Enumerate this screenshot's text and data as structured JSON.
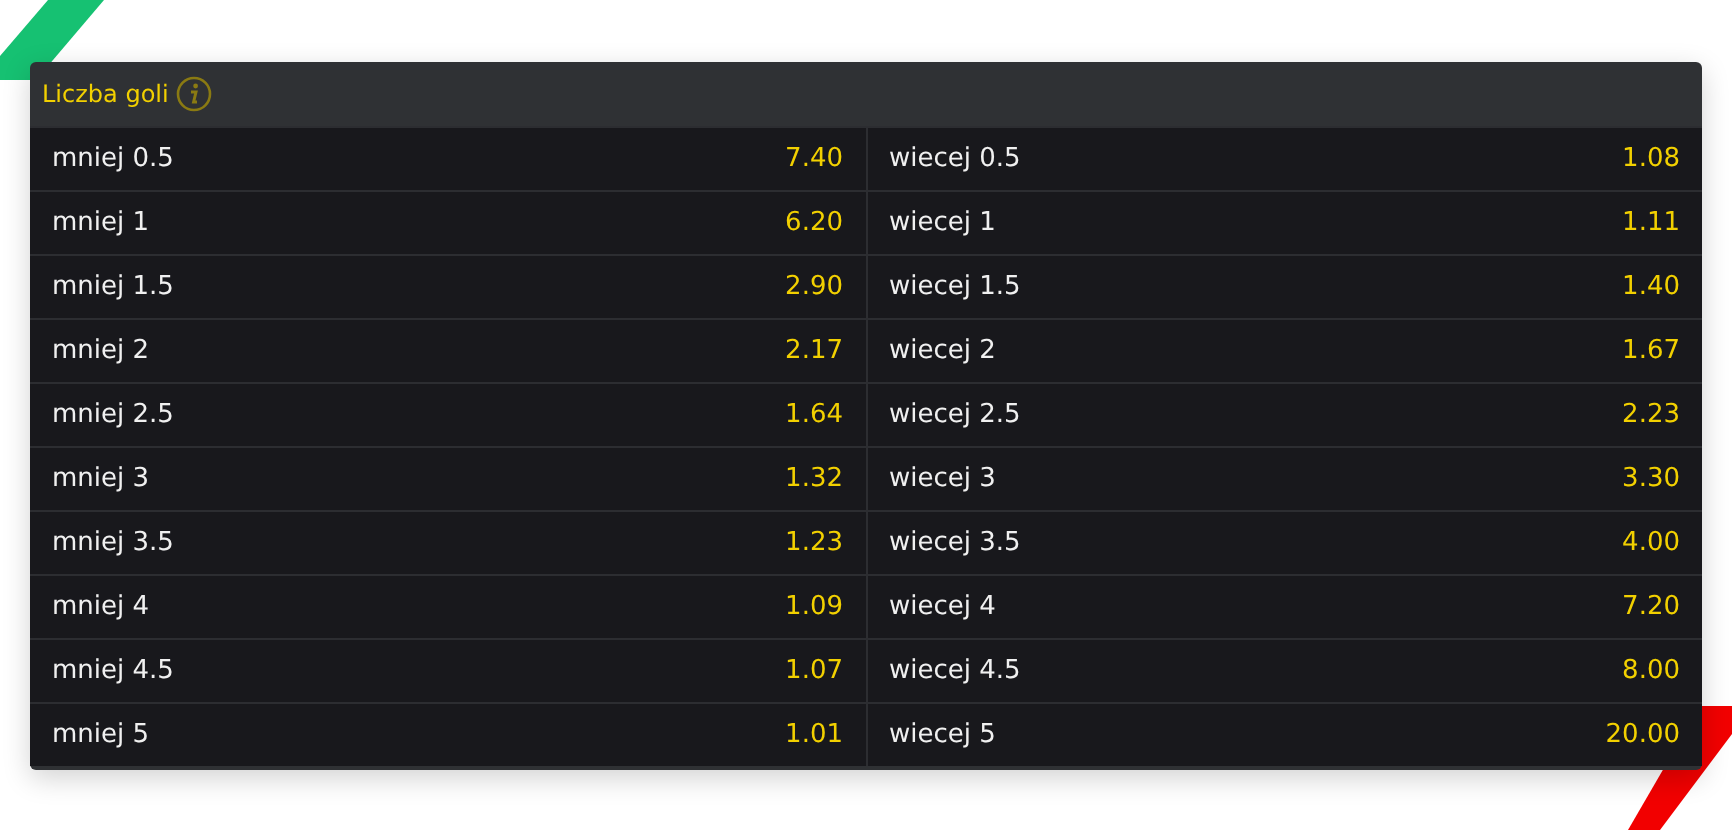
{
  "market": {
    "title": "Liczba goli",
    "rows": [
      [
        {
          "label": "mniej 0.5",
          "odds": "7.40"
        },
        {
          "label": "wiecej 0.5",
          "odds": "1.08"
        }
      ],
      [
        {
          "label": "mniej 1",
          "odds": "6.20"
        },
        {
          "label": "wiecej 1",
          "odds": "1.11"
        }
      ],
      [
        {
          "label": "mniej 1.5",
          "odds": "2.90"
        },
        {
          "label": "wiecej 1.5",
          "odds": "1.40"
        }
      ],
      [
        {
          "label": "mniej 2",
          "odds": "2.17"
        },
        {
          "label": "wiecej 2",
          "odds": "1.67"
        }
      ],
      [
        {
          "label": "mniej 2.5",
          "odds": "1.64"
        },
        {
          "label": "wiecej 2.5",
          "odds": "2.23"
        }
      ],
      [
        {
          "label": "mniej 3",
          "odds": "1.32"
        },
        {
          "label": "wiecej 3",
          "odds": "3.30"
        }
      ],
      [
        {
          "label": "mniej 3.5",
          "odds": "1.23"
        },
        {
          "label": "wiecej 3.5",
          "odds": "4.00"
        }
      ],
      [
        {
          "label": "mniej 4",
          "odds": "1.09"
        },
        {
          "label": "wiecej 4",
          "odds": "7.20"
        }
      ],
      [
        {
          "label": "mniej 4.5",
          "odds": "1.07"
        },
        {
          "label": "wiecej 4.5",
          "odds": "8.00"
        }
      ],
      [
        {
          "label": "mniej 5",
          "odds": "1.01"
        },
        {
          "label": "wiecej 5",
          "odds": "20.00"
        }
      ]
    ]
  }
}
